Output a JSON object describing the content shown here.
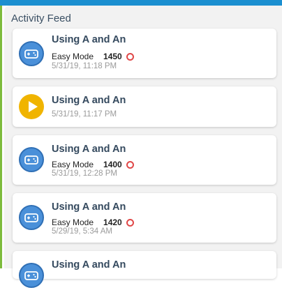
{
  "feed": {
    "title": "Activity Feed",
    "items": [
      {
        "title": "Using A and An",
        "mode": "Easy Mode",
        "score": "1450",
        "time": "5/31/19, 11:18 PM",
        "icon": "controller-icon"
      },
      {
        "title": "Using A and An",
        "time": "5/31/19, 11:17 PM",
        "icon": "play-icon"
      },
      {
        "title": "Using A and An",
        "mode": "Easy Mode",
        "score": "1400",
        "time": "5/31/19, 12:28 PM",
        "icon": "controller-icon"
      },
      {
        "title": "Using A and An",
        "mode": "Easy Mode",
        "score": "1420",
        "time": "5/29/19, 5:34 AM",
        "icon": "controller-icon"
      },
      {
        "title": "Using A and An",
        "icon": "controller-icon"
      }
    ]
  },
  "colors": {
    "topbar": "#1b8fd0",
    "stripe": "#7dbb3c",
    "controller": "#4a90d9",
    "play": "#f0b400",
    "badge": "#e04848"
  }
}
